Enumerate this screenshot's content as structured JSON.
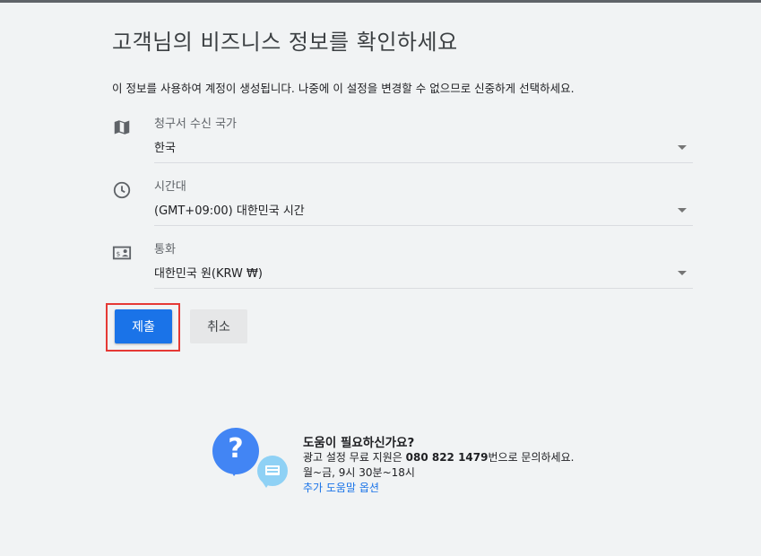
{
  "page": {
    "title": "고객님의 비즈니스 정보를 확인하세요",
    "description": "이 정보를 사용하여 계정이 생성됩니다. 나중에 이 설정을 변경할 수 없으므로 신중하게 선택하세요."
  },
  "fields": {
    "country": {
      "label": "청구서 수신 국가",
      "value": "한국",
      "icon": "map-icon"
    },
    "timezone": {
      "label": "시간대",
      "value": "(GMT+09:00) 대한민국 시간",
      "icon": "clock-icon"
    },
    "currency": {
      "label": "통화",
      "value": "대한민국 원(KRW ₩)",
      "icon": "currency-icon"
    }
  },
  "buttons": {
    "submit": "제출",
    "cancel": "취소"
  },
  "help": {
    "title": "도움이 필요하신가요?",
    "support_prefix": "광고 설정 무료 지원은 ",
    "phone": "080 822 1479",
    "support_suffix": "번으로 문의하세요.",
    "hours": "월~금, 9시 30분~18시",
    "link": "추가 도움말 옵션"
  },
  "colors": {
    "primary": "#1a73e8",
    "highlight": "#e53935",
    "background": "#f1f3f4"
  }
}
